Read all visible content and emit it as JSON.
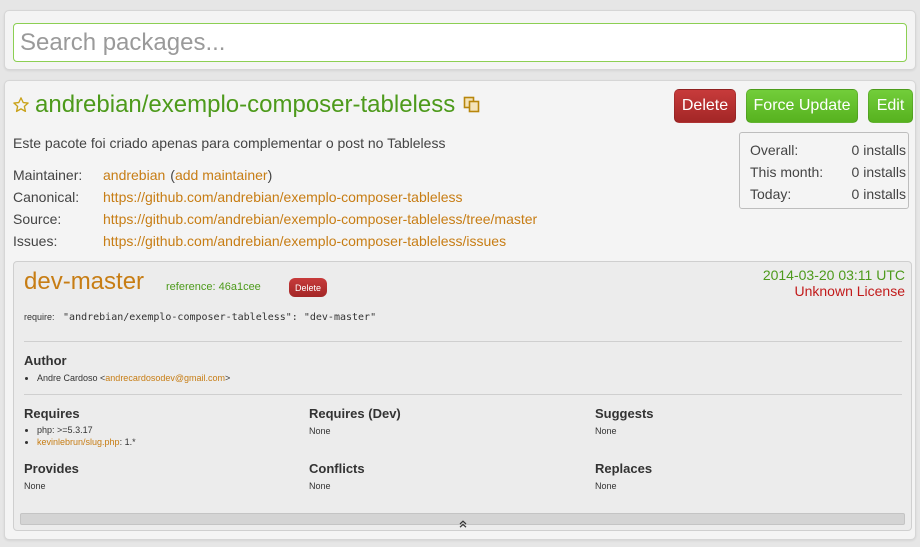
{
  "search": {
    "placeholder": "Search packages..."
  },
  "package": {
    "title": "andrebian/exemplo-composer-tableless",
    "description": "Este pacote foi criado apenas para complementar o post no Tableless",
    "buttons": {
      "delete": "Delete",
      "force_update": "Force Update",
      "edit": "Edit"
    },
    "meta": {
      "maintainer_label": "Maintainer:",
      "maintainer": "andrebian",
      "add_maintainer_open": "(",
      "add_maintainer": "add maintainer",
      "add_maintainer_close": ")",
      "canonical_label": "Canonical:",
      "canonical": "https://github.com/andrebian/exemplo-composer-tableless",
      "source_label": "Source:",
      "source": "https://github.com/andrebian/exemplo-composer-tableless/tree/master",
      "issues_label": "Issues:",
      "issues": "https://github.com/andrebian/exemplo-composer-tableless/issues"
    },
    "stats": {
      "overall_label": "Overall:",
      "overall": "0 installs",
      "month_label": "This month:",
      "month": "0 installs",
      "today_label": "Today:",
      "today": "0 installs"
    }
  },
  "version": {
    "name": "dev-master",
    "reference_label": "reference:",
    "reference": "46a1cee",
    "delete_label": "Delete",
    "date": "2014-03-20 03:11 UTC",
    "license": "Unknown License",
    "require_label": "require:",
    "require_value": "\"andrebian/exemplo-composer-tableless\": \"dev-master\"",
    "author_title": "Author",
    "author_name": "Andre Cardoso <",
    "author_email": "andrecardosodev@gmail.com",
    "author_close": ">",
    "requires_title": "Requires",
    "requires": [
      {
        "name": "php",
        "sep": ": ",
        "version": ">=5.3.17"
      },
      {
        "name": "kevinlebrun/slug.php",
        "sep": ": ",
        "version": "1.*"
      }
    ],
    "requires_dev_title": "Requires (Dev)",
    "requires_dev": "None",
    "suggests_title": "Suggests",
    "suggests": "None",
    "provides_title": "Provides",
    "provides": "None",
    "conflicts_title": "Conflicts",
    "conflicts": "None",
    "replaces_title": "Replaces",
    "replaces": "None"
  },
  "icons": {
    "star": "star-icon",
    "copy": "copy-icon",
    "collapse": "double-chevron-up-icon"
  },
  "colors": {
    "title_green": "#4d9a1b",
    "link_orange": "#c77d14",
    "danger_red": "#a32626",
    "success_green": "#57b21f",
    "license_red": "#c21b1b"
  }
}
